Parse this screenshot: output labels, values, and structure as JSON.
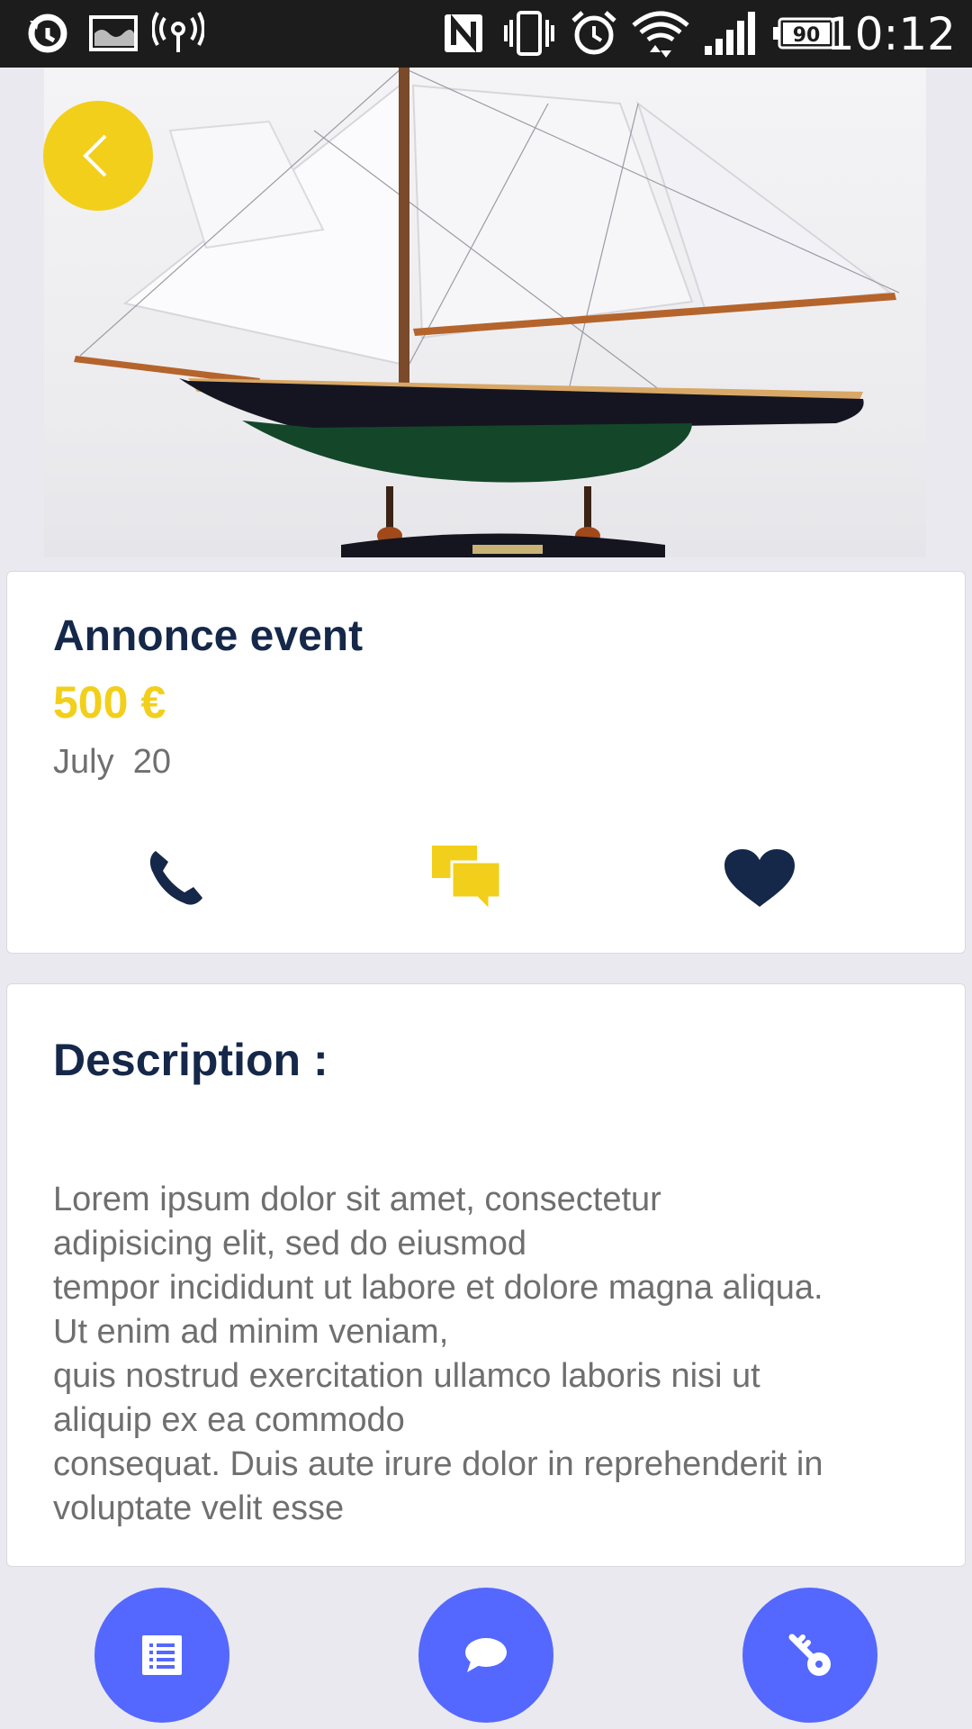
{
  "status_bar": {
    "time": "10:12",
    "battery": "90",
    "icons": [
      "sync-icon",
      "image-icon",
      "hotspot-icon",
      "nfc-icon",
      "vibrate-icon",
      "alarm-icon",
      "wifi-icon",
      "signal-icon",
      "battery-icon"
    ]
  },
  "hero": {
    "image": "sailboat-model-photo",
    "back_icon": "chevron-left-icon"
  },
  "listing": {
    "title": "Annonce event",
    "price": "500 €",
    "date": "July  20",
    "actions": [
      {
        "name": "call",
        "icon": "phone-icon"
      },
      {
        "name": "message",
        "icon": "chat-bubbles-icon"
      },
      {
        "name": "favorite",
        "icon": "heart-icon"
      }
    ]
  },
  "description": {
    "heading": "Description :",
    "lines": [
      "Lorem ipsum dolor sit amet, consectetur",
      "adipisicing elit, sed do eiusmod",
      "tempor incididunt ut labore et dolore magna aliqua.",
      "Ut enim ad minim veniam,",
      "quis nostrud exercitation ullamco laboris nisi ut",
      "aliquip ex ea commodo",
      "consequat. Duis aute irure dolor in reprehenderit in",
      "voluptate velit esse"
    ]
  },
  "bottom_nav": [
    {
      "name": "list",
      "icon": "list-icon"
    },
    {
      "name": "chat",
      "icon": "chat-icon"
    },
    {
      "name": "key",
      "icon": "key-icon"
    }
  ],
  "colors": {
    "accent_yellow": "#f2cf1a",
    "navy": "#15284a",
    "fab_blue": "#5468ff",
    "background": "#e9e9ef"
  }
}
